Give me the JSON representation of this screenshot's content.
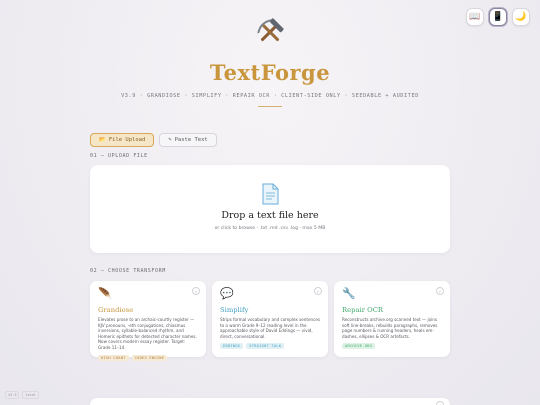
{
  "controls": {
    "reading_icon": "📖",
    "phone_icon": "📱",
    "theme_icon": "🌙"
  },
  "header": {
    "logo_icon": "hammer-and-pick",
    "title": "TextForge",
    "subtitle": "V3.9 · GRANDIOSE · SIMPLIFY · REPAIR OCR · CLIENT-SIDE ONLY · SEEDABLE + AUDITED"
  },
  "modes": {
    "file_upload_icon": "📂",
    "file_upload": "File Upload",
    "paste_text_icon": "✎",
    "paste_text": "Paste Text"
  },
  "upload": {
    "section_label": "01 — UPLOAD FILE",
    "drop_title": "Drop a text file here",
    "drop_hint": "or click to browse · .txt .md .csv .log · max 5 MB"
  },
  "transform": {
    "section_label": "02 — CHOOSE TRANSFORM",
    "cards": [
      {
        "icon": "🪶",
        "title": "Grandiose",
        "title_color": "#c9953d",
        "description": "Elevates prose to an archaic-courtly register — KJV pronouns, -eth conjugations, chiasmus inversions, syllable-balanced rhythm, and Homeric epithets for detected character names. Now covers modern essay register. Target: Grade 11–14.",
        "tags": [
          "HIGH CHANT",
          "CODEX ENGINE"
        ],
        "tag_bg": "#f6ead6",
        "tag_color": "#b0803a",
        "check": "✓"
      },
      {
        "icon": "💬",
        "title": "Simplify",
        "title_color": "#3f9fbf",
        "description": "Strips formal vocabulary and complex sentences to a warm Grade 9–12 reading level in the approachable style of David Eddings — vivid, direct, conversational.",
        "tags": [
          "EDDINGS",
          "STRAIGHT TALK"
        ],
        "tag_bg": "#dff0f5",
        "tag_color": "#3f9fbf",
        "check": "✓"
      },
      {
        "icon": "🔧",
        "title": "Repair OCR",
        "title_color": "#3faa6a",
        "description": "Reconstructs archive.org scanned text — joins soft line-breaks, rebuilds paragraphs, removes page numbers & running headers, heals em-dashes, ellipses & OCR artefacts.",
        "tags": [
          "ARCHIVE.ORG"
        ],
        "tag_bg": "#dff2e6",
        "tag_color": "#3faa6a",
        "check": "✓"
      }
    ]
  },
  "footer": {
    "badges": [
      "v3.9",
      "local"
    ],
    "strip_check": "✓"
  }
}
